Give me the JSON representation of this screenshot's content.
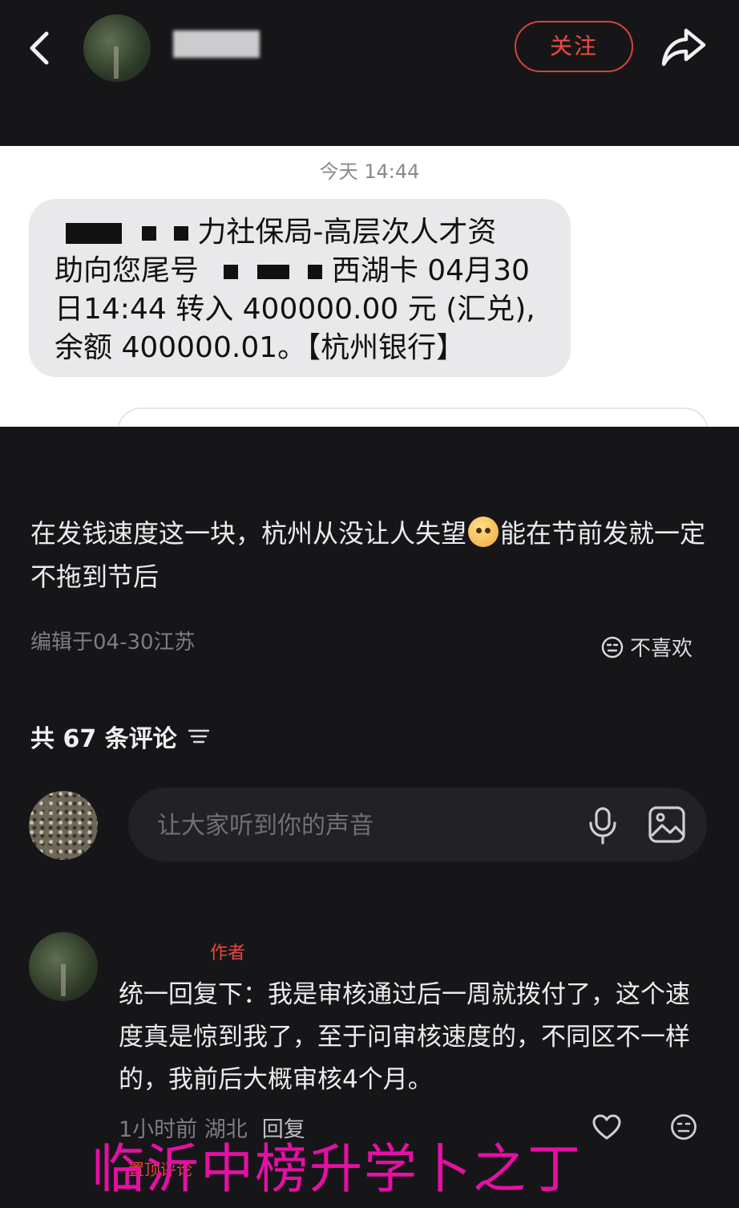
{
  "header": {
    "follow_label": "关注"
  },
  "sms": {
    "time": "今天 14:44",
    "lines": [
      "力社保局-高层次人才资",
      "助向您尾号",
      "西湖卡 04月30",
      "日14:44 转入 400000.00 元 (汇兑),",
      "余额 400000.01。【杭州银行】"
    ]
  },
  "post": {
    "text_part1": "在发钱速度这一块，杭州从没让人失望",
    "text_part2": "能在节前发就一定不拖到节后",
    "edit_meta": "编辑于04-30江苏",
    "dislike_label": "不喜欢"
  },
  "comments": {
    "count_label": "共 67 条评论",
    "input_placeholder": "让大家听到你的声音"
  },
  "reply": {
    "author_tag": "作者",
    "text": "统一回复下：我是审核通过后一周就拨付了，这个速度真是惊到我了，至于问审核速度的，不同区不一样的，我前后大概审核4个月。",
    "time_location": "1小时前 湖北",
    "reply_label": "回复",
    "pin_label": "置顶评论"
  },
  "watermark": "临沂中榜升学卜之丁",
  "colors": {
    "accent_red": "#ef4b3e",
    "watermark": "#e60fa4",
    "background": "#161619"
  }
}
